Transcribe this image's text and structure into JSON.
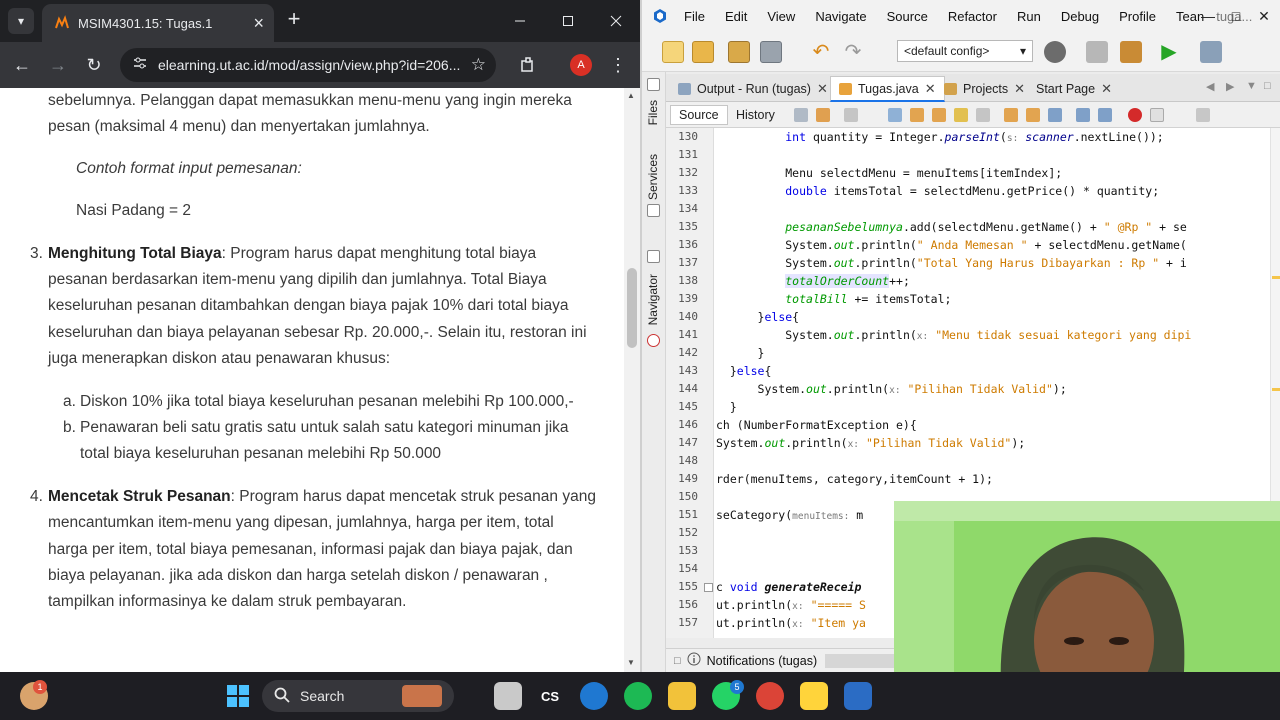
{
  "browser": {
    "tab_title": "MSIM4301.15: Tugas.1",
    "url": "elearning.ut.ac.id/mod/assign/view.php?id=206...",
    "profile_initial": "A"
  },
  "assignment": {
    "lines_top": [
      "sebelumnya. Pelanggan dapat memasukkan menu-menu yang ingin mereka",
      "pesan (maksimal 4 menu) dan menyertakan jumlahnya."
    ],
    "example_label": "Contoh format input pemesanan:",
    "example_value": "Nasi Padang = 2",
    "item3": {
      "number": "3.",
      "title": "Menghitung Total Biaya",
      "lines": [
        ": Program harus dapat menghitung total biaya",
        "pesanan berdasarkan item-menu yang dipilih dan jumlahnya. Total Biaya",
        "keseluruhan pesanan ditambahkan dengan biaya pajak 10% dari total biaya",
        "keseluruhan dan biaya pelayanan sebesar Rp. 20.000,-. Selain itu, restoran ini",
        "juga menerapkan diskon atau penawaran khusus:"
      ],
      "sub_a_marker": "a.",
      "sub_a": "Diskon 10% jika total biaya keseluruhan pesanan melebihi Rp 100.000,-",
      "sub_b_marker": "b.",
      "sub_b_1": "Penawaran beli satu gratis satu untuk salah satu kategori minuman jika",
      "sub_b_2": "total biaya keseluruhan pesanan melebihi Rp 50.000"
    },
    "item4": {
      "number": "4.",
      "title": "Mencetak Struk Pesanan",
      "lines": [
        ": Program harus dapat mencetak struk pesanan yang",
        "mencantumkan item-menu yang dipesan, jumlahnya, harga per item, total",
        "harga per item, total biaya pemesanan, informasi pajak dan biaya pajak, dan",
        "biaya pelayanan. jika ada diskon dan harga setelah diskon / penawaran ,",
        "tampilkan informasinya ke dalam struk pembayaran."
      ]
    }
  },
  "ide": {
    "menu": [
      "File",
      "Edit",
      "View",
      "Navigate",
      "Source",
      "Refactor",
      "Run",
      "Debug",
      "Profile",
      "Tean",
      "tuga..."
    ],
    "config": "<default config>",
    "side_tabs": [
      "Files",
      "Services",
      "Navigator"
    ],
    "doc_tabs": [
      "Output - Run (tugas)",
      "Tugas.java",
      "Projects",
      "Start Page"
    ],
    "editor_tabs": [
      "Source",
      "History"
    ],
    "code_lines": [
      {
        "n": "130",
        "html": "          <span class=\"kw\">int</span> quantity = Integer.<span class=\"ivar\">parseInt</span>(<span class=\"hint\">s:</span> <span class=\"ivar\">scanner</span>.nextLine());"
      },
      {
        "n": "131",
        "html": ""
      },
      {
        "n": "132",
        "html": "          Menu selectdMenu = menuItems[itemIndex];"
      },
      {
        "n": "133",
        "html": "          <span class=\"kw\">double</span> itemsTotal = selectdMenu.getPrice() * quantity;"
      },
      {
        "n": "134",
        "html": ""
      },
      {
        "n": "135",
        "html": "          <span class=\"fld\">pesananSebelumnya</span>.add(selectdMenu.getName() + <span class=\"str\">\" @Rp \"</span> + se"
      },
      {
        "n": "136",
        "html": "          System.<span class=\"fld\">out</span>.println(<span class=\"str\">\" Anda Memesan \"</span> + selectdMenu.getName("
      },
      {
        "n": "137",
        "html": "          System.<span class=\"fld\">out</span>.println(<span class=\"str\">\"Total Yang Harus Dibayarkan : Rp \"</span> + i"
      },
      {
        "n": "138",
        "html": "          <span class=\"fld hl\">totalOrderCount</span>++;"
      },
      {
        "n": "139",
        "html": "          <span class=\"fld\">totalBill</span> += itemsTotal;"
      },
      {
        "n": "140",
        "html": "      }<span class=\"kw\">else</span>{"
      },
      {
        "n": "141",
        "html": "          System.<span class=\"fld\">out</span>.println(<span class=\"hint\">x:</span> <span class=\"str\">\"Menu tidak sesuai kategori yang dipi</span>"
      },
      {
        "n": "142",
        "html": "      }"
      },
      {
        "n": "143",
        "html": "  }<span class=\"kw\">else</span>{"
      },
      {
        "n": "144",
        "html": "      System.<span class=\"fld\">out</span>.println(<span class=\"hint\">x:</span> <span class=\"str\">\"Pilihan Tidak Valid\"</span>);"
      },
      {
        "n": "145",
        "html": "  }"
      },
      {
        "n": "146",
        "html": "ch (NumberFormatException e){"
      },
      {
        "n": "147",
        "html": "System.<span class=\"fld\">out</span>.println(<span class=\"hint\">x:</span> <span class=\"str\">\"Pilihan Tidak Valid\"</span>);"
      },
      {
        "n": "148",
        "html": ""
      },
      {
        "n": "149",
        "html": "rder(menuItems, category,itemCount + 1);"
      },
      {
        "n": "150",
        "html": ""
      },
      {
        "n": "151",
        "html": "seCategory(<span class=\"hint\">menuItems:</span> m"
      },
      {
        "n": "152",
        "html": ""
      },
      {
        "n": "153",
        "html": ""
      },
      {
        "n": "154",
        "html": ""
      },
      {
        "n": "155",
        "html": "c <span class=\"kw\">void</span> <span class=\"meth\">generateReceip</span>"
      },
      {
        "n": "156",
        "html": "ut.println(<span class=\"hint\">x:</span> <span class=\"str\">\"===== S</span>"
      },
      {
        "n": "157",
        "html": "ut.println(<span class=\"hint\">x:</span> <span class=\"str\">\"Item ya</span>"
      }
    ],
    "status_text": "Notifications (tugas)"
  },
  "taskbar": {
    "search_label": "Search",
    "notification_badge": "1",
    "whatsapp_badge": "5",
    "cs_label": "CS"
  },
  "colors": {
    "chrome_dark": "#202124",
    "chrome_toolbar": "#35363a",
    "keyword": "#0000e6",
    "string": "#ce7b00",
    "field": "#009900",
    "taskbar": "#1e1e23",
    "webcam_bg": "#8ed866"
  }
}
